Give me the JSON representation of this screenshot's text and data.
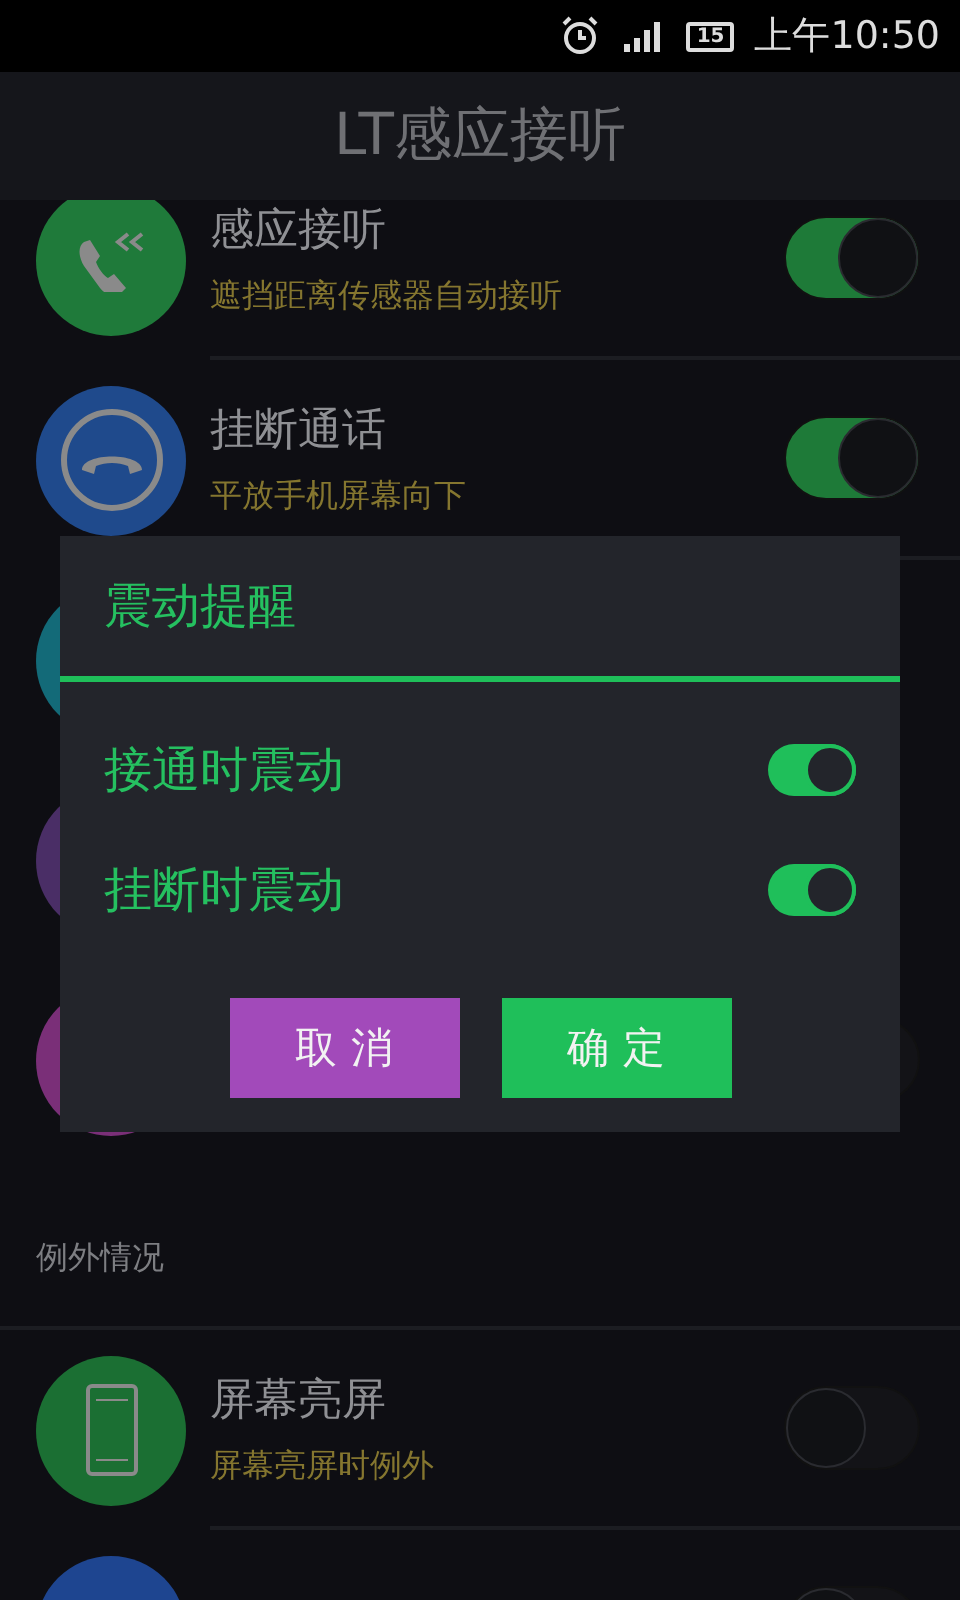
{
  "status_bar": {
    "battery": "15",
    "time": "上午10:50"
  },
  "title": "LT感应接听",
  "settings": [
    {
      "kind": "answer",
      "color": "#1f7a3a",
      "title": "感应接听",
      "subtitle": "遮挡距离传感器自动接听",
      "on": true
    },
    {
      "kind": "hangup",
      "color": "#1f4a8c",
      "title": "挂断通话",
      "subtitle": "平放手机屏幕向下",
      "on": true
    },
    {
      "color": "#136a78"
    },
    {
      "color": "#4a2e66"
    },
    {
      "color": "#7a2f78",
      "on": false
    }
  ],
  "section": {
    "title": "例外情况",
    "settings": [
      {
        "kind": "phone",
        "color": "#1b6f33",
        "title": "屏幕亮屏",
        "subtitle": "屏幕亮屏时例外",
        "on": false
      },
      {
        "color": "#1e4590",
        "on": false
      }
    ]
  },
  "dialog": {
    "title": "震动提醒",
    "options": [
      {
        "label": "接通时震动",
        "on": true
      },
      {
        "label": "挂断时震动",
        "on": true
      }
    ],
    "buttons": [
      {
        "kind": "cancel",
        "label": "取 消"
      },
      {
        "kind": "ok",
        "label": "确 定"
      }
    ]
  }
}
